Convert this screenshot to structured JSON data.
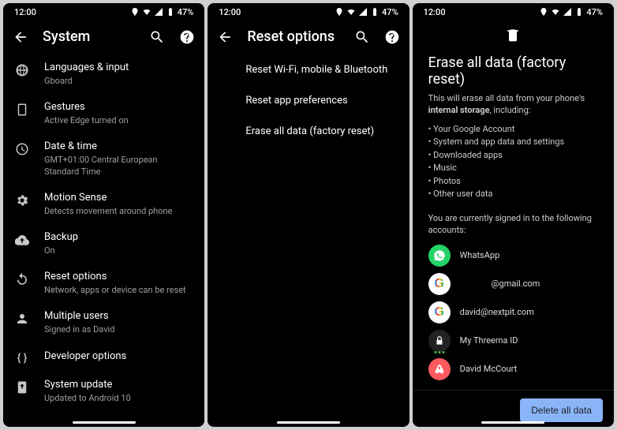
{
  "status": {
    "time": "12:00",
    "battery": "47%"
  },
  "screen1": {
    "title": "System",
    "items": [
      {
        "title": "Languages & input",
        "sub": "Gboard"
      },
      {
        "title": "Gestures",
        "sub": "Active Edge turned on"
      },
      {
        "title": "Date & time",
        "sub": "GMT+01:00 Central European Standard Time"
      },
      {
        "title": "Motion Sense",
        "sub": "Detects movement around phone"
      },
      {
        "title": "Backup",
        "sub": "On"
      },
      {
        "title": "Reset options",
        "sub": "Network, apps or device can be reset"
      },
      {
        "title": "Multiple users",
        "sub": "Signed in as David"
      },
      {
        "title": "Developer options",
        "sub": ""
      },
      {
        "title": "System update",
        "sub": "Updated to Android 10"
      }
    ]
  },
  "screen2": {
    "title": "Reset options",
    "items": [
      "Reset Wi-Fi, mobile & Bluetooth",
      "Reset app preferences",
      "Erase all data (factory reset)"
    ]
  },
  "screen3": {
    "title": "Erase all data (factory reset)",
    "lead_pre": "This will erase all data from your phone's ",
    "lead_bold": "internal storage",
    "lead_post": ", including:",
    "bullets": [
      "Your Google Account",
      "System and app data and settings",
      "Downloaded apps",
      "Music",
      "Photos",
      "Other user data"
    ],
    "signed": "You are currently signed in to the following accounts:",
    "accounts": [
      {
        "kind": "whatsapp",
        "label": "WhatsApp"
      },
      {
        "kind": "google",
        "label": "@gmail.com"
      },
      {
        "kind": "google",
        "label": "david@nextpit.com"
      },
      {
        "kind": "threema",
        "label": "My Threema ID"
      },
      {
        "kind": "airbnb",
        "label": "David McCourt"
      }
    ],
    "button": "Delete all data"
  }
}
